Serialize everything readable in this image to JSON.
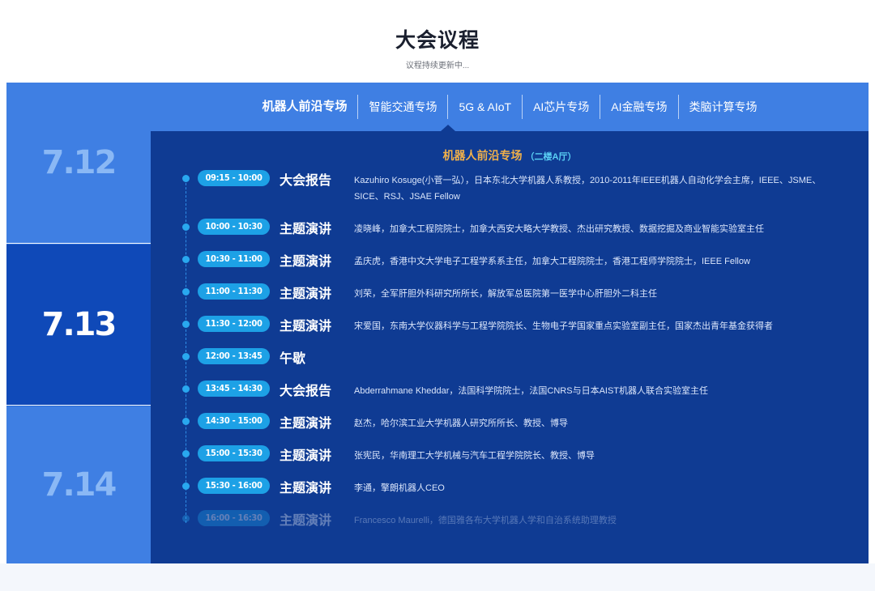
{
  "header": {
    "title": "大会议程",
    "subtitle": "议程持续更新中..."
  },
  "dates": [
    "7.12",
    "7.13",
    "7.14"
  ],
  "tabs": [
    {
      "label": "机器人前沿专场",
      "active": true
    },
    {
      "label": "智能交通专场",
      "active": false
    },
    {
      "label": "5G & AIoT",
      "active": false
    },
    {
      "label": "AI芯片专场",
      "active": false
    },
    {
      "label": "AI金融专场",
      "active": false
    },
    {
      "label": "类脑计算专场",
      "active": false
    }
  ],
  "session": {
    "name": "机器人前沿专场",
    "room": "（二楼A厅）"
  },
  "agenda": [
    {
      "time": "09:15 - 10:00",
      "kind": "大会报告",
      "desc": "Kazuhiro Kosuge(小菅一弘），日本东北大学机器人系教授，2010-2011年IEEE机器人自动化学会主席，IEEE、JSME、SICE、RSJ、JSAE Fellow"
    },
    {
      "time": "10:00 - 10:30",
      "kind": "主题演讲",
      "desc": "凌晓峰，加拿大工程院院士，加拿大西安大略大学教授、杰出研究教授、数据挖掘及商业智能实验室主任"
    },
    {
      "time": "10:30 - 11:00",
      "kind": "主题演讲",
      "desc": "孟庆虎，香港中文大学电子工程学系系主任，加拿大工程院院士，香港工程师学院院士，IEEE Fellow"
    },
    {
      "time": "11:00 - 11:30",
      "kind": "主题演讲",
      "desc": "刘荣，全军肝胆外科研究所所长，解放军总医院第一医学中心肝胆外二科主任"
    },
    {
      "time": "11:30 - 12:00",
      "kind": "主题演讲",
      "desc": "宋爱国，东南大学仪器科学与工程学院院长、生物电子学国家重点实验室副主任，国家杰出青年基金获得者"
    },
    {
      "time": "12:00 - 13:45",
      "kind": "午歇",
      "desc": ""
    },
    {
      "time": "13:45 - 14:30",
      "kind": "大会报告",
      "desc": "Abderrahmane Kheddar，法国科学院院士，法国CNRS与日本AIST机器人联合实验室主任"
    },
    {
      "time": "14:30 - 15:00",
      "kind": "主题演讲",
      "desc": "赵杰，哈尔滨工业大学机器人研究所所长、教授、博导"
    },
    {
      "time": "15:00 - 15:30",
      "kind": "主题演讲",
      "desc": "张宪民，华南理工大学机械与汽车工程学院院长、教授、博导"
    },
    {
      "time": "15:30 - 16:00",
      "kind": "主题演讲",
      "desc": "李通，擎朗机器人CEO"
    },
    {
      "time": "16:00 - 16:30",
      "kind": "主题演讲",
      "desc": "Francesco Maurelli，德国雅各布大学机器人学和自治系统助理教授"
    }
  ]
}
